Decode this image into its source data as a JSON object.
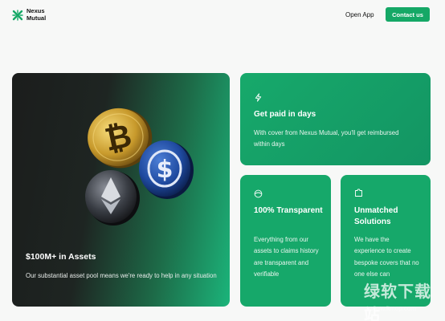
{
  "header": {
    "logo_text": "Nexus\nMutual",
    "open_app": "Open App",
    "contact": "Contact us"
  },
  "hero": {
    "title": "$100M+ in Assets",
    "desc": "Our substantial asset pool means we're ready to help in any situation"
  },
  "cards": [
    {
      "icon": "lightning-icon",
      "title": "Get paid in days",
      "desc": "With cover from Nexus Mutual, you'll get reimbursed within days"
    },
    {
      "icon": "eye-icon",
      "title": "100% Transparent",
      "desc": "Everything from our assets to claims history are transparent and verifiable"
    },
    {
      "icon": "puzzle-icon",
      "title": "Unmatched Solutions",
      "desc": "We have the experience to create bespoke covers that no one else can"
    }
  ],
  "watermark": {
    "text": "绿软下载站",
    "url": "www.itmop.com"
  },
  "colors": {
    "accent": "#15a866",
    "dark": "#1b1d1c"
  }
}
